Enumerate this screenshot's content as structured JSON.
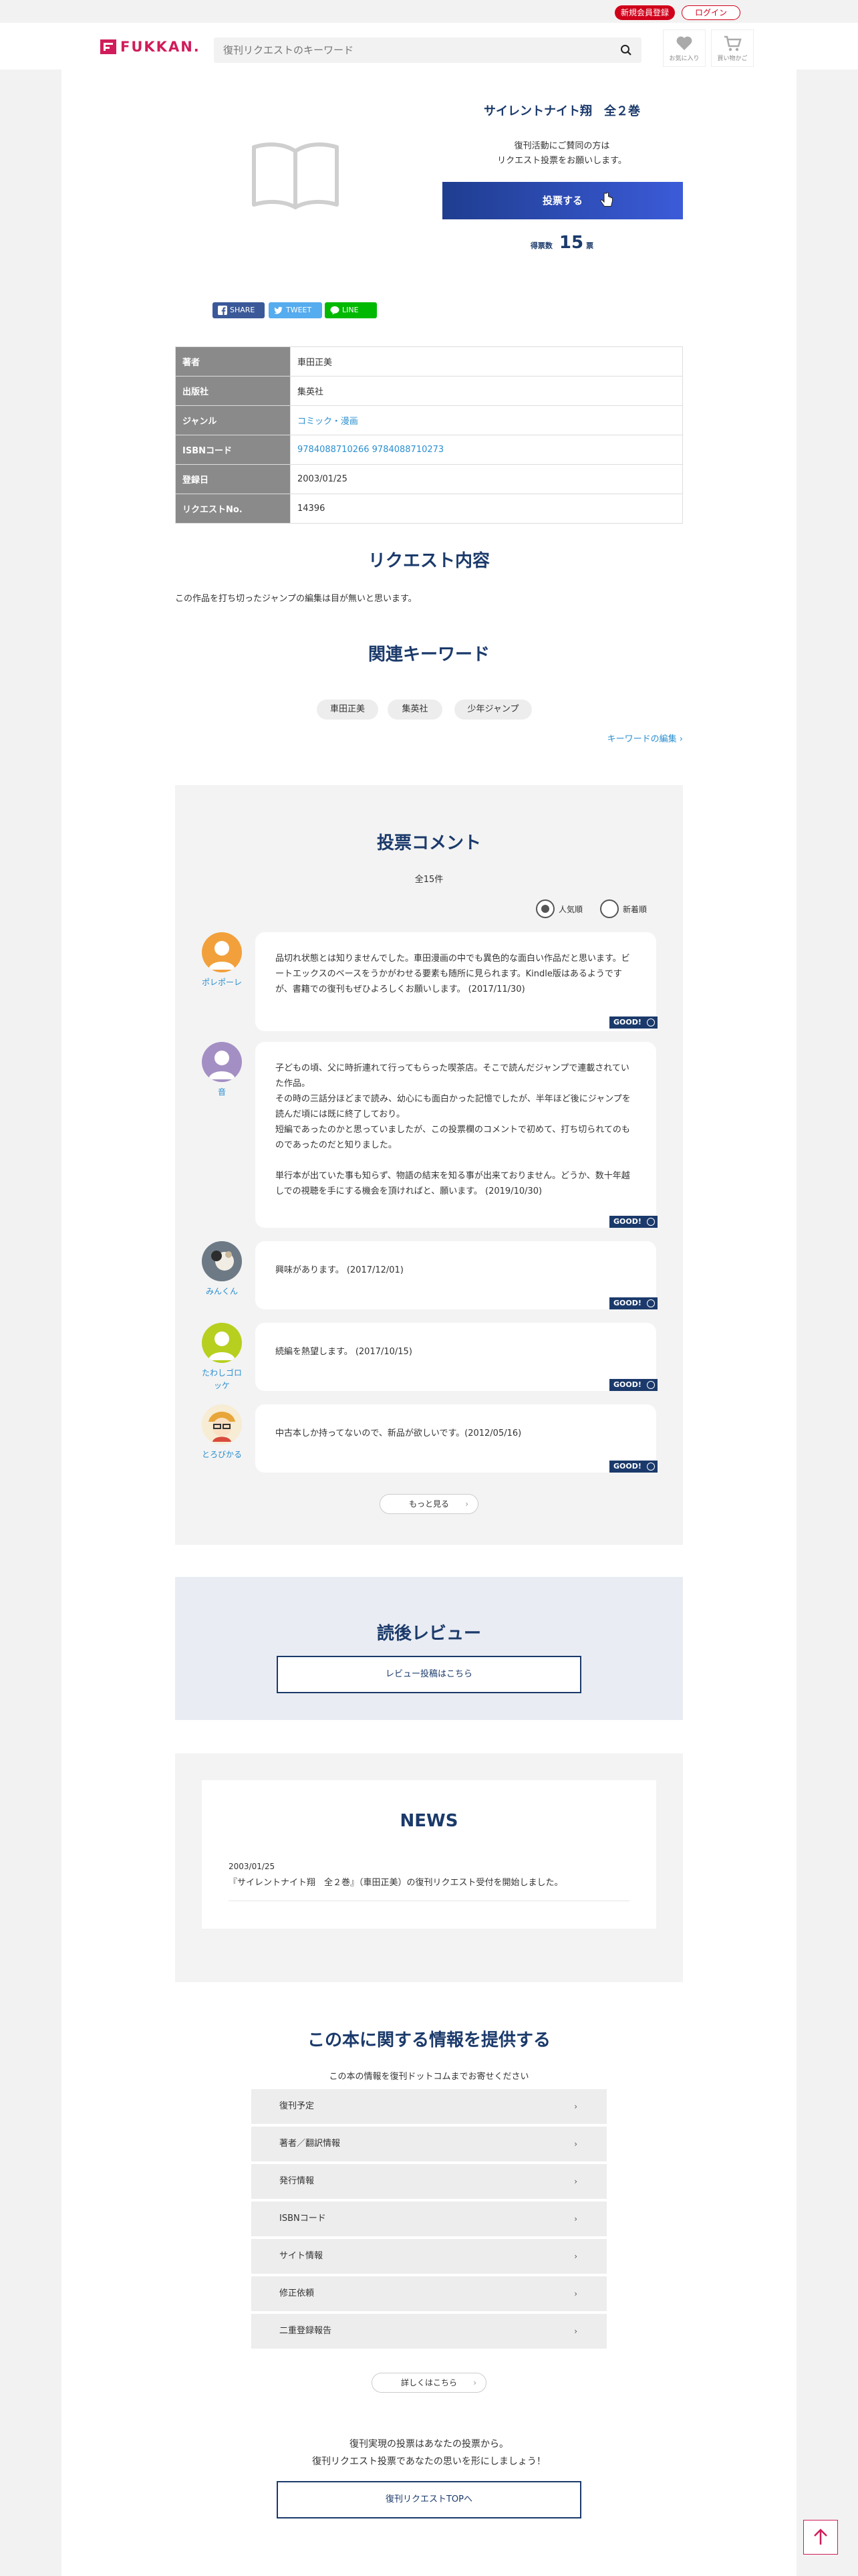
{
  "top_bar": {
    "register_label": "新規会員登録",
    "login_label": "ログイン"
  },
  "header": {
    "logo_text": "FUKKAN.",
    "search_placeholder": "復刊リクエストのキーワード",
    "favorites_label": "お気に入り",
    "cart_label": "買い物かご"
  },
  "book": {
    "title": "サイレントナイト翔　全２巻",
    "vote_desc_1": "復刊活動にご賛同の方は",
    "vote_desc_2": "リクエスト投票をお願いします。",
    "vote_button": "投票する",
    "vote_count_label": "得票数",
    "vote_count": "15",
    "vote_count_unit": "票"
  },
  "share": {
    "facebook": "SHARE",
    "twitter": "TWEET",
    "line": "LINE"
  },
  "info": [
    {
      "label": "著者",
      "value": "車田正美"
    },
    {
      "label": "出版社",
      "value": "集英社"
    },
    {
      "label": "ジャンル",
      "value": "コミック・漫画"
    },
    {
      "label": "ISBNコード",
      "value": "9784088710266 9784088710273"
    },
    {
      "label": "登録日",
      "value": "2003/01/25"
    },
    {
      "label": "リクエストNo.",
      "value": "14396"
    }
  ],
  "request": {
    "title": "リクエスト内容",
    "text": "この作品を打ち切ったジャンプの編集は目が無いと思います。"
  },
  "keywords": {
    "title": "関連キーワード",
    "items": [
      "車田正美",
      "集英社",
      "少年ジャンプ"
    ],
    "edit_link": "キーワードの編集"
  },
  "comments": {
    "title": "投票コメント",
    "total": "全15件",
    "sort_popular": "人気順",
    "sort_new": "新着順",
    "good_label": "GOOD!",
    "items": [
      {
        "user": "ポレポーレ",
        "lines": [
          "品切れ状態とは知りませんでした。車田漫画の中でも異色的な面白い作品だと思います。ビ",
          "ートエックスのベースをうかがわせる要素も随所に見られます。Kindle版はあるようです",
          "が、書籍での復刊もぜひよろしくお願いします。 (2017/11/30)"
        ]
      },
      {
        "user": "音",
        "lines": [
          "子どもの頃、父に時折連れて行ってもらった喫茶店。そこで読んだジャンプで連載されてい",
          "た作品。",
          "その時の三話分ほどまで読み、幼心にも面白かった記憶でしたが、半年ほど後にジャンプを",
          "読んだ頃には既に終了しており。",
          "短編であったのかと思っていましたが、この投票欄のコメントで初めて、打ち切られてのも",
          "のであったのだと知りました。",
          "",
          "単行本が出ていた事も知らず、物語の結末を知る事が出来ておりません。どうか、数十年越",
          "しでの視聴を手にする機会を頂ければと、願います。 (2019/10/30)"
        ]
      },
      {
        "user": "みんくん",
        "lines": [
          "興味があります。 (2017/12/01)"
        ]
      },
      {
        "user_1": "たわしゴロ",
        "user_2": "ッケ",
        "lines": [
          "続編を熱望します。 (2017/10/15)"
        ]
      },
      {
        "user": "とろびかる",
        "lines": [
          "中古本しか持ってないので、新品が欲しいです。(2012/05/16)"
        ]
      }
    ],
    "more_label": "もっと見る"
  },
  "review": {
    "title": "読後レビュー",
    "button": "レビュー投稿はこちら"
  },
  "news": {
    "title": "NEWS",
    "date": "2003/01/25",
    "text": "『サイレントナイト翔　全２巻』（車田正美）の復刊リクエスト受付を開始しました。"
  },
  "provide": {
    "title": "この本に関する情報を提供する",
    "subtitle": "この本の情報を復刊ドットコムまでお寄せください",
    "items": [
      "復刊予定",
      "著者／翻訳情報",
      "発行情報",
      "ISBNコード",
      "サイト情報",
      "修正依頼",
      "二重登録報告"
    ],
    "details_label": "詳しくはこちら"
  },
  "footer": {
    "line1": "復刊実現の投票はあなたの投票から。",
    "line2": "復刊リクエスト投票であなたの思いを形にしましょう！",
    "top_button": "復刊リクエストTOPへ"
  },
  "colors": {
    "brand": "#d01c5b",
    "navy": "#1b3a6b",
    "link": "#2a8fd0",
    "register": "#d0021b"
  }
}
